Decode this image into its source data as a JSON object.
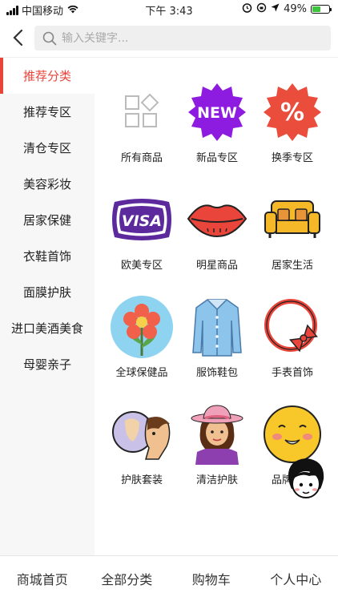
{
  "status_bar": {
    "carrier": "中国移动",
    "time": "下午 3:43",
    "battery": "49%",
    "battery_level": 0.49,
    "icons": [
      "signal-icon",
      "wifi-icon",
      "alarm-icon",
      "lock-rotation-icon",
      "location-icon",
      "battery-icon"
    ]
  },
  "search": {
    "placeholder": "输入关键字..."
  },
  "sidebar": {
    "items": [
      {
        "label": "推荐分类",
        "active": true
      },
      {
        "label": "推荐专区"
      },
      {
        "label": "清仓专区"
      },
      {
        "label": "美容彩妆"
      },
      {
        "label": "居家保健"
      },
      {
        "label": "衣鞋首饰"
      },
      {
        "label": "面膜护肤"
      },
      {
        "label": "进口美酒美食"
      },
      {
        "label": "母婴亲子"
      }
    ]
  },
  "grid": {
    "items": [
      {
        "label": "所有商品",
        "icon": "grid-icon"
      },
      {
        "label": "新品专区",
        "icon": "new-badge-icon"
      },
      {
        "label": "换季专区",
        "icon": "percent-badge-icon"
      },
      {
        "label": "欧美专区",
        "icon": "visa-card-icon"
      },
      {
        "label": "明星商品",
        "icon": "lips-icon"
      },
      {
        "label": "居家生活",
        "icon": "sofa-icon"
      },
      {
        "label": "全球保健品",
        "icon": "flower-icon"
      },
      {
        "label": "服饰鞋包",
        "icon": "shirt-icon"
      },
      {
        "label": "手表首饰",
        "icon": "bracelet-icon"
      },
      {
        "label": "护肤套装",
        "icon": "mirror-face-icon"
      },
      {
        "label": "清洁护肤",
        "icon": "woman-hat-icon"
      },
      {
        "label": "品牌国货",
        "icon": "smiley-icon"
      }
    ]
  },
  "tabbar": {
    "tabs": [
      "商城首页",
      "全部分类",
      "购物车",
      "个人中心"
    ]
  },
  "colors": {
    "accent": "#e8443a",
    "sidebar_bg": "#f7f7f7",
    "search_bg": "#efefef"
  }
}
